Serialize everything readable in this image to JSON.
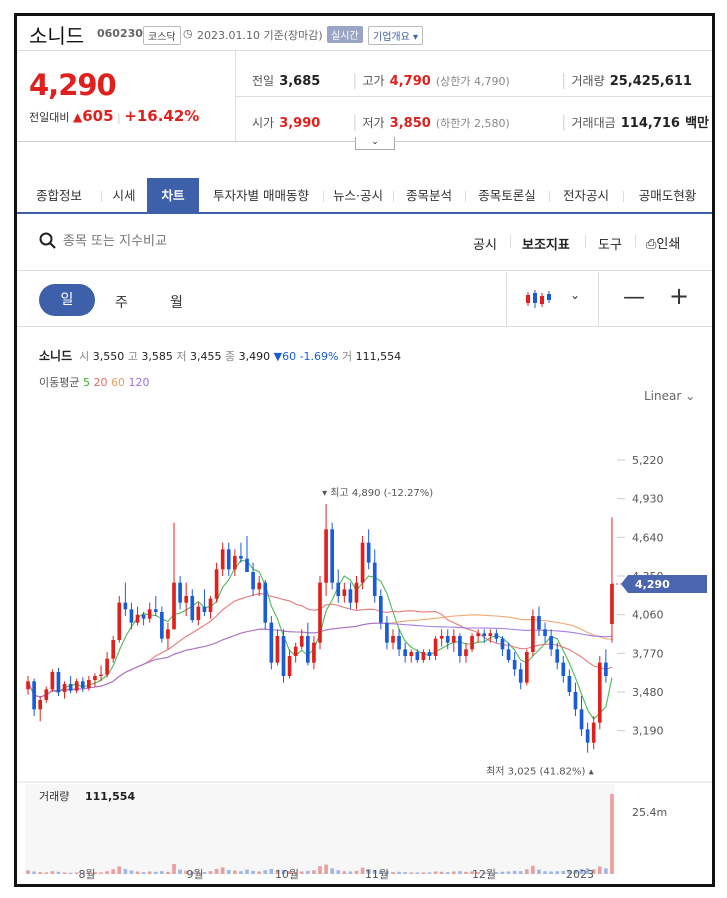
{
  "stock": {
    "name": "소니드",
    "code": "060230",
    "market": "코스닥",
    "date_label": "2023.01.10 기준(장마감)",
    "realtime_badge": "실시간",
    "overview_button": "기업개요",
    "price": "4,290",
    "change_label": "전일대비",
    "change_value": "605",
    "change_pct": "+16.42%"
  },
  "quote": {
    "prev_label": "전일",
    "prev_value": "3,685",
    "high_label": "고가",
    "high_value": "4,790",
    "upper_limit": "(상한가 4,790)",
    "volume_label": "거래량",
    "volume_value": "25,425,611",
    "open_label": "시가",
    "open_value": "3,990",
    "low_label": "저가",
    "low_value": "3,850",
    "lower_limit": "(하한가 2,580)",
    "amount_label": "거래대금",
    "amount_value": "114,716",
    "amount_unit": "백만"
  },
  "tabs": [
    "종합정보",
    "시세",
    "차트",
    "투자자별 매매동향",
    "뉴스·공시",
    "종목분석",
    "종목토론실",
    "전자공시",
    "공매도현황"
  ],
  "active_tab": "차트",
  "toolbar": {
    "search_placeholder": "종목 또는 지수비교",
    "disclosure": "공시",
    "indicators": "보조지표",
    "tools": "도구",
    "print": "인쇄"
  },
  "periods": {
    "day": "일",
    "week": "주",
    "month": "월"
  },
  "scale_label": "Linear",
  "info": {
    "name": "소니드",
    "open_label": "시",
    "open": "3,550",
    "high_label": "고",
    "high": "3,585",
    "low_label": "저",
    "low": "3,455",
    "close_label": "종",
    "close": "3,490",
    "change": "60 -1.69%",
    "vol_label": "거",
    "vol": "111,554"
  },
  "ma": {
    "label": "이동평균",
    "p5": "5",
    "p20": "20",
    "p60": "60",
    "p120": "120"
  },
  "colors": {
    "up": "#e0201c",
    "down": "#1a5bd8",
    "ma5": "#3cb043",
    "ma20": "#e86a6a",
    "ma60": "#f0a060",
    "ma120": "#a070e0",
    "accent": "#3e5fa9"
  },
  "chart_data": {
    "type": "candlestick",
    "y_ticks": [
      "5,220",
      "4,930",
      "4,640",
      "4,350",
      "4,060",
      "3,770",
      "3,480",
      "3,190"
    ],
    "ylim": [
      3000,
      5400
    ],
    "x_ticks": [
      "8월",
      "9월",
      "10월",
      "11월",
      "12월",
      "2023"
    ],
    "current_price_label": "4,290",
    "high_annotation": "최고 4,890 (-12.27%)",
    "low_annotation": "최저 3,025 (41.82%)",
    "volume_label": "거래량",
    "volume_value": "111,554",
    "volume_axis_tick": "25.4m",
    "candles": [
      [
        3500,
        3600,
        3460,
        3560
      ],
      [
        3560,
        3580,
        3300,
        3350
      ],
      [
        3350,
        3450,
        3260,
        3420
      ],
      [
        3420,
        3520,
        3400,
        3500
      ],
      [
        3500,
        3650,
        3480,
        3630
      ],
      [
        3630,
        3660,
        3450,
        3480
      ],
      [
        3480,
        3560,
        3430,
        3540
      ],
      [
        3540,
        3600,
        3470,
        3490
      ],
      [
        3490,
        3580,
        3470,
        3560
      ],
      [
        3560,
        3590,
        3480,
        3510
      ],
      [
        3510,
        3600,
        3490,
        3570
      ],
      [
        3570,
        3620,
        3520,
        3600
      ],
      [
        3600,
        3680,
        3560,
        3610
      ],
      [
        3610,
        3780,
        3590,
        3730
      ],
      [
        3730,
        3900,
        3700,
        3870
      ],
      [
        3870,
        4200,
        3850,
        4150
      ],
      [
        4150,
        4300,
        4050,
        4100
      ],
      [
        4100,
        4150,
        3950,
        4000
      ],
      [
        4000,
        4120,
        3980,
        4060
      ],
      [
        4060,
        4080,
        3980,
        4030
      ],
      [
        4030,
        4150,
        4000,
        4100
      ],
      [
        4100,
        4200,
        4050,
        4080
      ],
      [
        4080,
        4120,
        3850,
        3880
      ],
      [
        3880,
        4000,
        3800,
        3950
      ],
      [
        3950,
        4750,
        3950,
        4300
      ],
      [
        4300,
        4350,
        4100,
        4150
      ],
      [
        4150,
        4300,
        4050,
        4200
      ],
      [
        4200,
        4250,
        4000,
        4020
      ],
      [
        4020,
        4150,
        3980,
        4120
      ],
      [
        4120,
        4250,
        4050,
        4080
      ],
      [
        4080,
        4200,
        4030,
        4180
      ],
      [
        4180,
        4450,
        4150,
        4400
      ],
      [
        4400,
        4600,
        4350,
        4550
      ],
      [
        4550,
        4600,
        4350,
        4400
      ],
      [
        4400,
        4550,
        4350,
        4500
      ],
      [
        4500,
        4600,
        4450,
        4480
      ],
      [
        4480,
        4650,
        4420,
        4380
      ],
      [
        4380,
        4450,
        4200,
        4250
      ],
      [
        4250,
        4350,
        4200,
        4300
      ],
      [
        4300,
        4320,
        3950,
        4000
      ],
      [
        4000,
        4050,
        3650,
        3700
      ],
      [
        3700,
        3950,
        3680,
        3900
      ],
      [
        3900,
        3950,
        3550,
        3600
      ],
      [
        3600,
        3800,
        3580,
        3750
      ],
      [
        3750,
        3850,
        3700,
        3820
      ],
      [
        3820,
        3950,
        3800,
        3900
      ],
      [
        3900,
        4000,
        3680,
        3700
      ],
      [
        3700,
        3900,
        3650,
        3850
      ],
      [
        3850,
        4350,
        3800,
        4300
      ],
      [
        4300,
        4890,
        4200,
        4700
      ],
      [
        4700,
        4750,
        4250,
        4300
      ],
      [
        4300,
        4400,
        4150,
        4200
      ],
      [
        4200,
        4300,
        4150,
        4250
      ],
      [
        4250,
        4300,
        4100,
        4150
      ],
      [
        4150,
        4350,
        4100,
        4300
      ],
      [
        4300,
        4650,
        4250,
        4600
      ],
      [
        4600,
        4700,
        4400,
        4450
      ],
      [
        4450,
        4550,
        4150,
        4200
      ],
      [
        4200,
        4250,
        3950,
        4000
      ],
      [
        4000,
        4050,
        3800,
        3850
      ],
      [
        3850,
        3950,
        3800,
        3900
      ],
      [
        3900,
        3950,
        3750,
        3800
      ],
      [
        3800,
        3850,
        3700,
        3750
      ],
      [
        3750,
        3800,
        3700,
        3780
      ],
      [
        3780,
        3800,
        3700,
        3720
      ],
      [
        3720,
        3800,
        3700,
        3780
      ],
      [
        3780,
        3800,
        3720,
        3750
      ],
      [
        3750,
        3900,
        3720,
        3880
      ],
      [
        3880,
        3950,
        3820,
        3900
      ],
      [
        3900,
        3950,
        3800,
        3850
      ],
      [
        3850,
        3950,
        3780,
        3900
      ],
      [
        3900,
        3920,
        3700,
        3750
      ],
      [
        3750,
        3850,
        3700,
        3800
      ],
      [
        3800,
        3920,
        3780,
        3900
      ],
      [
        3900,
        3950,
        3850,
        3920
      ],
      [
        3920,
        3950,
        3850,
        3900
      ],
      [
        3900,
        3950,
        3850,
        3920
      ],
      [
        3920,
        3950,
        3850,
        3880
      ],
      [
        3880,
        3900,
        3750,
        3800
      ],
      [
        3800,
        3850,
        3700,
        3720
      ],
      [
        3720,
        3780,
        3600,
        3650
      ],
      [
        3650,
        3700,
        3500,
        3550
      ],
      [
        3550,
        3800,
        3530,
        3780
      ],
      [
        3780,
        4100,
        3750,
        4050
      ],
      [
        4050,
        4120,
        3900,
        3950
      ],
      [
        3950,
        4000,
        3850,
        3900
      ],
      [
        3900,
        3950,
        3750,
        3800
      ],
      [
        3800,
        3850,
        3650,
        3700
      ],
      [
        3700,
        3750,
        3550,
        3600
      ],
      [
        3600,
        3650,
        3450,
        3480
      ],
      [
        3480,
        3550,
        3300,
        3350
      ],
      [
        3350,
        3450,
        3150,
        3200
      ],
      [
        3200,
        3250,
        3025,
        3100
      ],
      [
        3100,
        3300,
        3050,
        3250
      ],
      [
        3250,
        3750,
        3200,
        3700
      ],
      [
        3700,
        3800,
        3550,
        3600
      ],
      [
        3990,
        4790,
        3850,
        4290
      ]
    ],
    "volumes": [
      1.2,
      0.8,
      0.6,
      0.5,
      0.9,
      0.7,
      0.5,
      0.4,
      0.5,
      0.4,
      0.5,
      0.6,
      0.5,
      0.9,
      1.5,
      2.4,
      1.6,
      1.1,
      0.8,
      0.6,
      0.8,
      0.7,
      0.9,
      0.7,
      3.2,
      1.4,
      1.0,
      0.8,
      0.7,
      0.6,
      0.9,
      1.6,
      2.1,
      1.3,
      1.1,
      0.9,
      1.4,
      1.0,
      0.8,
      1.2,
      1.6,
      1.1,
      1.3,
      0.9,
      0.7,
      0.8,
      1.0,
      1.2,
      2.5,
      3.0,
      1.8,
      1.2,
      0.9,
      0.8,
      1.0,
      2.0,
      1.6,
      1.1,
      1.0,
      0.9,
      0.6,
      0.7,
      0.6,
      0.5,
      0.5,
      0.5,
      0.5,
      0.8,
      0.7,
      0.6,
      0.8,
      0.9,
      0.7,
      0.8,
      0.6,
      0.5,
      0.5,
      0.6,
      0.7,
      0.8,
      1.0,
      0.9,
      1.5,
      2.6,
      1.4,
      0.9,
      0.8,
      0.9,
      1.0,
      1.1,
      1.3,
      1.6,
      1.8,
      1.5,
      2.4,
      1.8,
      25.4
    ]
  }
}
